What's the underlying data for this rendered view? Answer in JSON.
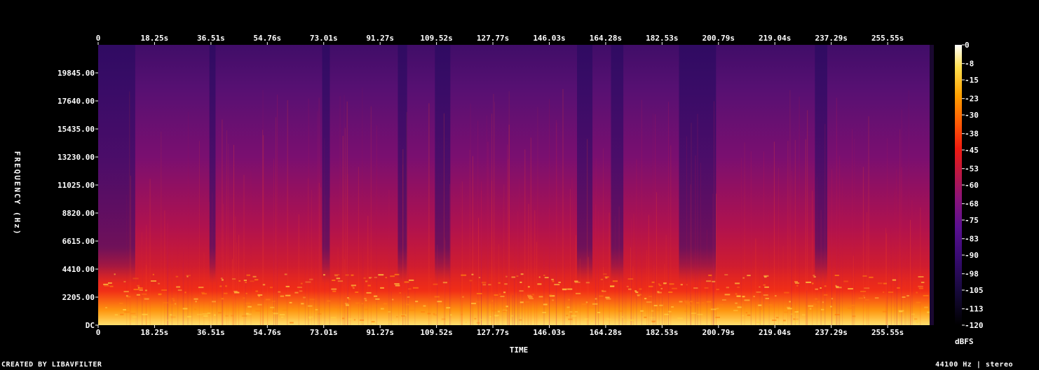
{
  "chart_data": {
    "type": "heatmap",
    "x_ticks": [
      "0",
      "18.25s",
      "36.51s",
      "54.76s",
      "73.01s",
      "91.27s",
      "109.52s",
      "127.77s",
      "146.03s",
      "164.28s",
      "182.53s",
      "200.79s",
      "219.04s",
      "237.29s",
      "255.55s"
    ],
    "x_tick_values": [
      0,
      18.25,
      36.51,
      54.76,
      73.01,
      91.27,
      109.52,
      127.77,
      146.03,
      164.28,
      182.53,
      200.79,
      219.04,
      237.29,
      255.55
    ],
    "xlim": [
      0,
      270.5
    ],
    "y_ticks": [
      "DC",
      "2205.00",
      "4410.00",
      "6615.00",
      "8820.00",
      "11025.00",
      "13230.00",
      "15435.00",
      "17640.00",
      "19845.00"
    ],
    "y_tick_values": [
      0,
      2205,
      4410,
      6615,
      8820,
      11025,
      13230,
      15435,
      17640,
      19845
    ],
    "ylim": [
      0,
      22050
    ],
    "xlabel": "TIME",
    "ylabel": "FREQUENCY (Hz)",
    "colorbar": {
      "ticks": [
        "0",
        "-8",
        "-15",
        "-23",
        "-30",
        "-38",
        "-45",
        "-53",
        "-60",
        "-68",
        "-75",
        "-83",
        "-90",
        "-98",
        "-105",
        "-113",
        "-120"
      ],
      "range": [
        -120,
        0
      ],
      "unit": "dBFS",
      "colormap": [
        "#000000",
        "#1a0b40",
        "#4a0d80",
        "#80138a",
        "#b31a6a",
        "#e0202e",
        "#ff5a0a",
        "#ffa800",
        "#ffe060",
        "#ffffff"
      ]
    },
    "grid": false
  },
  "footer": {
    "left": "CREATED BY LIBAVFILTER",
    "right": "44100 Hz | stereo"
  }
}
